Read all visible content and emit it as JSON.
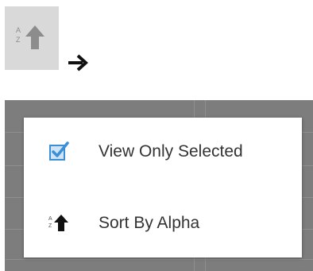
{
  "toolbar": {
    "sort_button_icon": "sort-alpha-ascending-icon",
    "sort_button_letter_top": "A",
    "sort_button_letter_bottom": "Z"
  },
  "transition_icon": "arrow-right-icon",
  "menu": {
    "items": [
      {
        "label": "View Only Selected",
        "icon": "checked-checkbox-icon"
      },
      {
        "label": "Sort By Alpha",
        "icon": "sort-alpha-ascending-icon",
        "icon_letter_top": "A",
        "icon_letter_bottom": "Z"
      }
    ]
  },
  "colors": {
    "button_bg": "#d9d9d9",
    "arrow_gray": "#8c8c8c",
    "overlay_bg": "#7d7d7d",
    "checkbox_blue": "#3b8fd6",
    "menu_text": "#333333"
  }
}
